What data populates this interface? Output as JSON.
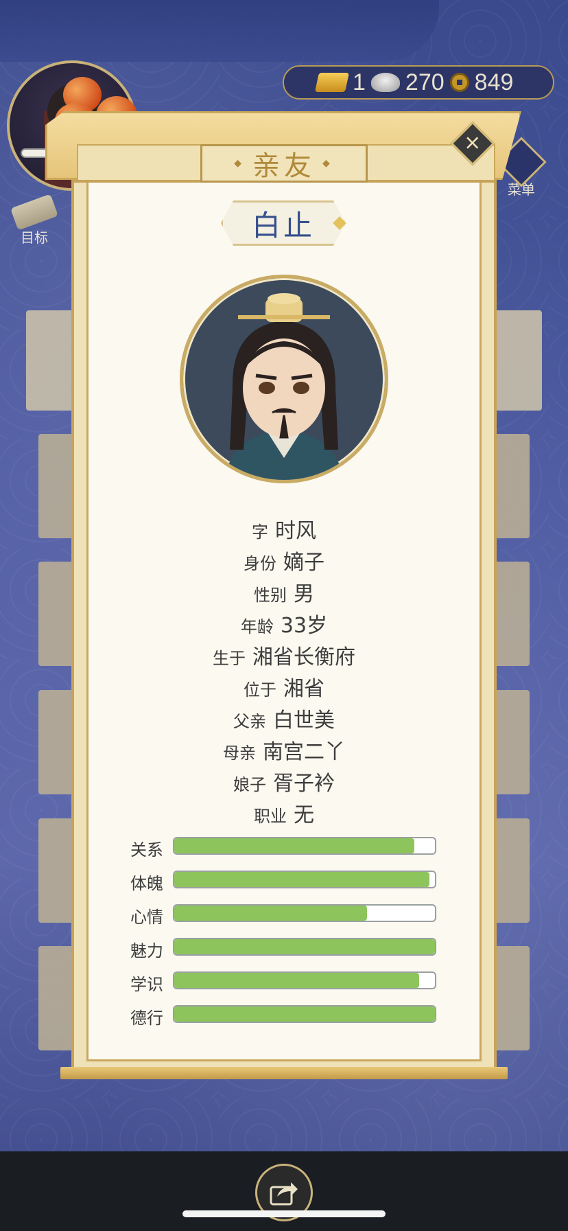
{
  "header": {
    "currency": {
      "gold": "1",
      "silver": "270",
      "copper": "849"
    },
    "left_button_label": "目标",
    "menu_label": "菜单"
  },
  "modal": {
    "title": "亲友",
    "name": "白止",
    "info": [
      {
        "key": "字",
        "value": "时风"
      },
      {
        "key": "身份",
        "value": "嫡子"
      },
      {
        "key": "性别",
        "value": "男"
      },
      {
        "key": "年龄",
        "value": "33岁"
      },
      {
        "key": "生于",
        "value": "湘省长衡府"
      },
      {
        "key": "位于",
        "value": "湘省"
      },
      {
        "key": "父亲",
        "value": "白世美"
      },
      {
        "key": "母亲",
        "value": "南宫二丫"
      },
      {
        "key": "娘子",
        "value": "胥子衿"
      },
      {
        "key": "职业",
        "value": "无"
      }
    ],
    "stats": [
      {
        "label": "关系",
        "percent": 92
      },
      {
        "label": "体魄",
        "percent": 98
      },
      {
        "label": "心情",
        "percent": 74
      },
      {
        "label": "魅力",
        "percent": 100
      },
      {
        "label": "学识",
        "percent": 94
      },
      {
        "label": "德行",
        "percent": 100
      }
    ],
    "colors": {
      "bar_fill": "#8dc45c",
      "name_text": "#35508c",
      "frame": "#c7a35a"
    }
  }
}
